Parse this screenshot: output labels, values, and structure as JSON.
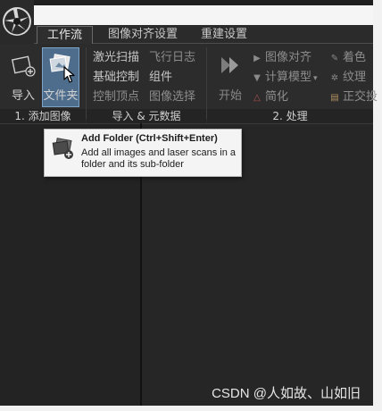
{
  "tabs": [
    {
      "label": "工作流",
      "active": true
    },
    {
      "label": "图像对齐设置",
      "active": false
    },
    {
      "label": "重建设置",
      "active": false
    }
  ],
  "groups": {
    "add_images": {
      "label": "1. 添加图像",
      "import_label": "导入",
      "folder_label": "文件夹"
    },
    "import_metadata": {
      "label": "导入 & 元数据",
      "items": [
        "激光扫描",
        "飞行日志",
        "基础控制",
        "组件",
        "控制顶点",
        "图像选择"
      ]
    },
    "process": {
      "label": "2. 处理",
      "start_label": "开始",
      "items": [
        "图像对齐",
        "计算模型",
        "简化",
        "着色",
        "纹理",
        "正交投"
      ]
    }
  },
  "tooltip": {
    "title": "Add Folder (Ctrl+Shift+Enter)",
    "description": "Add all images and laser scans in a folder and its sub-folder"
  },
  "watermark": "CSDN @人如故、山如旧",
  "colors": {
    "background": "#1f1f1f",
    "ribbon": "#2c2c2c",
    "selected_button": "#4e6d8c",
    "tooltip_bg": "#f4f4f4"
  }
}
